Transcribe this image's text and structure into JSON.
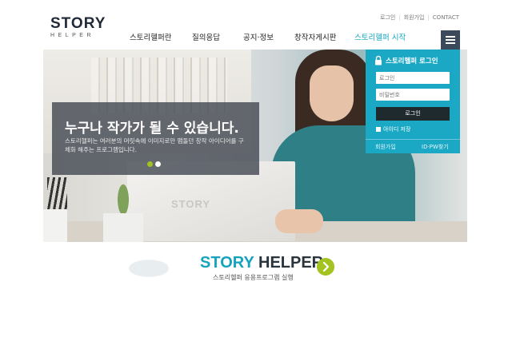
{
  "header": {
    "util_links": [
      "로그인",
      "회원가입",
      "CONTACT"
    ],
    "logo": {
      "top": "STORY",
      "bottom": "HELPER"
    },
    "nav": [
      {
        "label": "스토리헬퍼란",
        "active": false
      },
      {
        "label": "질의응답",
        "active": false
      },
      {
        "label": "공지·정보",
        "active": false
      },
      {
        "label": "창작자게시판",
        "active": false
      },
      {
        "label": "스토리헬퍼 시작",
        "active": true
      }
    ]
  },
  "hero": {
    "title": "누구나 작가가 될 수 있습니다.",
    "desc": "스토리헬퍼는 여러분의 머릿속에 이미지로만 맴돌던 창작 아이디어를 구체화 해주는 프로그램입니다.",
    "laptop_logo": "STORY",
    "slides_count": 2,
    "active_slide": 1
  },
  "login": {
    "title": "스토리헬퍼 로그인",
    "id_placeholder": "로그인",
    "pw_placeholder": "비밀번호",
    "button": "로그인",
    "remember": "아이디 저장",
    "signup": "회원가입",
    "find": "ID·PW찾기"
  },
  "start": {
    "title_part1": "STORY",
    "title_part2": "HELPER",
    "subtitle": "스토리헬퍼 응용프로그램 실행"
  },
  "colors": {
    "accent": "#16a3bd",
    "green": "#a4c320",
    "dark": "#29343d"
  }
}
